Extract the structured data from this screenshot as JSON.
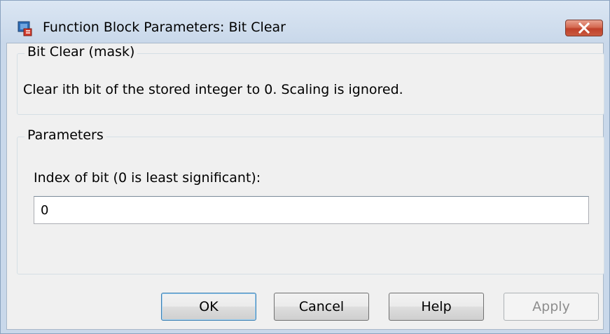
{
  "window": {
    "title": "Function Block Parameters: Bit Clear",
    "icon": "simulink-block-icon",
    "close_icon": "close-icon"
  },
  "mask_group": {
    "title": "Bit Clear (mask)",
    "description": "Clear ith bit of the stored integer to 0.  Scaling is ignored."
  },
  "parameters_group": {
    "title": "Parameters",
    "index_label": "Index of bit (0 is least significant):",
    "index_value": "0"
  },
  "buttons": {
    "ok": "OK",
    "cancel": "Cancel",
    "help": "Help",
    "apply": "Apply"
  },
  "colors": {
    "close_button": "#c95a40",
    "default_button_border": "#3c7fb1"
  }
}
